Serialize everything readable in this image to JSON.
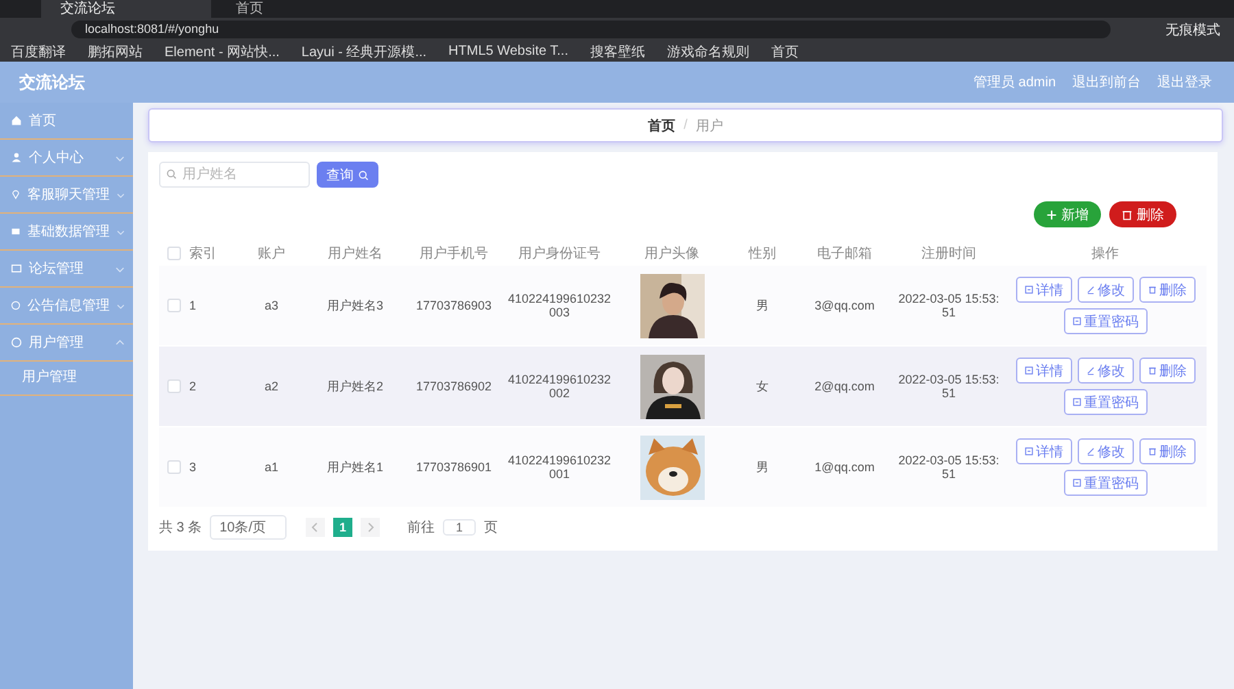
{
  "browser": {
    "tabs": [
      {
        "title": "交流论坛",
        "selected": true
      },
      {
        "title": "首页",
        "selected": false
      }
    ],
    "url": "localhost:8081/#/yonghu",
    "profile": "无痕模式",
    "bookmarks": [
      "百度翻译",
      "鹏拓网站",
      "Element - 网站快...",
      "Layui - 经典开源模...",
      "HTML5 Website T...",
      "搜客壁纸",
      "游戏命名规则",
      "首页"
    ]
  },
  "header": {
    "title": "交流论坛",
    "links": [
      "管理员 admin",
      "退出到前台",
      "退出登录"
    ]
  },
  "sidebar": {
    "items": [
      {
        "label": "首页",
        "submenu": false
      },
      {
        "label": "个人中心",
        "submenu": true,
        "expanded": false
      },
      {
        "label": "客服聊天管理",
        "submenu": true,
        "expanded": false
      },
      {
        "label": "基础数据管理",
        "submenu": true,
        "expanded": false
      },
      {
        "label": "论坛管理",
        "submenu": true,
        "expanded": false
      },
      {
        "label": "公告信息管理",
        "submenu": true,
        "expanded": false
      },
      {
        "label": "用户管理",
        "submenu": true,
        "expanded": true,
        "children": [
          {
            "label": "用户管理"
          }
        ]
      }
    ]
  },
  "breadcrumb": {
    "items": [
      "首页",
      "用户"
    ],
    "separator": "/"
  },
  "search": {
    "placeholder": "用户姓名",
    "button": "查询"
  },
  "actions": [
    {
      "label": "新增",
      "kind": "add"
    },
    {
      "label": "删除",
      "kind": "delete"
    }
  ],
  "table": {
    "columns": [
      "索引",
      "账户",
      "用户姓名",
      "用户手机号",
      "用户身份证号",
      "用户头像",
      "性别",
      "电子邮箱",
      "注册时间",
      "操作"
    ],
    "header_checked": false,
    "rows": [
      {
        "checked": false,
        "cells": [
          "1",
          "a3",
          "用户姓名3",
          "17703786903",
          "410224199610232003"
        ],
        "avatar": {
          "kind": "picture"
        },
        "sex": "男",
        "email": "3@qq.com",
        "time": "2022-03-05 15:53:51",
        "buttons": [
          {
            "label": "详情",
            "kind": "detail"
          },
          {
            "label": "修改",
            "kind": "edit"
          },
          {
            "label": "删除",
            "kind": "delete"
          },
          {
            "label": "重置密码",
            "kind": "reset"
          }
        ]
      },
      {
        "checked": false,
        "cells": [
          "2",
          "a2",
          "用户姓名2",
          "17703786902",
          "410224199610232002"
        ],
        "avatar": {
          "kind": "picture"
        },
        "sex": "女",
        "email": "2@qq.com",
        "time": "2022-03-05 15:53:51",
        "buttons": [
          {
            "label": "详情",
            "kind": "detail"
          },
          {
            "label": "修改",
            "kind": "edit"
          },
          {
            "label": "删除",
            "kind": "delete"
          },
          {
            "label": "重置密码",
            "kind": "reset"
          }
        ]
      },
      {
        "checked": false,
        "cells": [
          "3",
          "a1",
          "用户姓名1",
          "17703786901",
          "410224199610232001"
        ],
        "avatar": {
          "kind": "picture"
        },
        "sex": "男",
        "email": "1@qq.com",
        "time": "2022-03-05 15:53:51",
        "buttons": [
          {
            "label": "详情",
            "kind": "detail"
          },
          {
            "label": "修改",
            "kind": "edit"
          },
          {
            "label": "删除",
            "kind": "delete"
          },
          {
            "label": "重置密码",
            "kind": "reset"
          }
        ]
      }
    ]
  },
  "pagination": {
    "total": "共 3 条",
    "page_size": "10条/页",
    "pages": [
      {
        "label": "1",
        "selected": true
      }
    ],
    "goto": "前往",
    "goto_value": "1",
    "suffix": "页"
  }
}
